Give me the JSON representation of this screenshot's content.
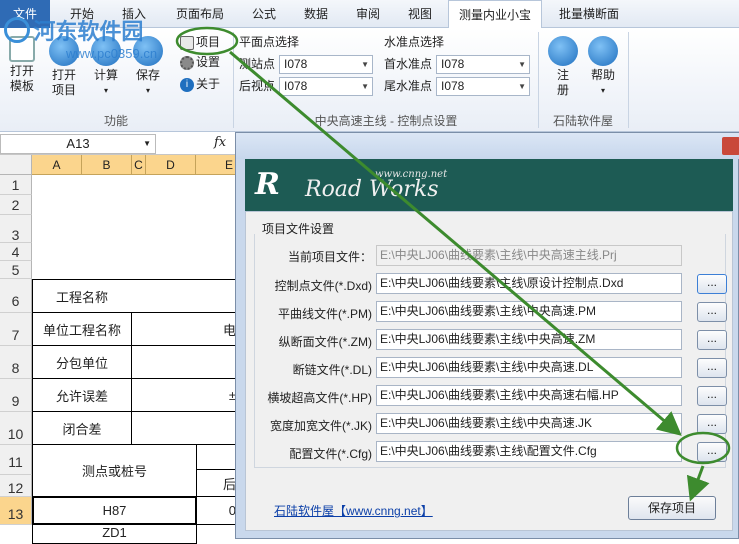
{
  "watermark": {
    "site": "河东软件园",
    "url": "www.pc0359.cn"
  },
  "tabs": [
    {
      "label": "文件"
    },
    {
      "label": "开始"
    },
    {
      "label": "插入"
    },
    {
      "label": "页面布局"
    },
    {
      "label": "公式"
    },
    {
      "label": "数据"
    },
    {
      "label": "审阅"
    },
    {
      "label": "视图"
    },
    {
      "label": "测量内业小宝"
    },
    {
      "label": "批量横断面"
    }
  ],
  "ribbon": {
    "function_group": {
      "label": "功能",
      "buttons": [
        {
          "label": "打开",
          "label2": "模板"
        },
        {
          "label": "打开",
          "label2": "项目"
        },
        {
          "label": "计算",
          "label2": "▾"
        },
        {
          "label": "保存",
          "label2": "▾"
        }
      ],
      "small_buttons": [
        {
          "label": "项目"
        },
        {
          "label": "设置"
        },
        {
          "label": "关于"
        }
      ]
    },
    "points_group": {
      "label": "中央高速主线 - 控制点设置",
      "plane_title": "平面点选择",
      "station_label": "测站点",
      "station_value": "I078",
      "backsight_label": "后视点",
      "backsight_value": "I078",
      "level_title": "水准点选择",
      "first_label": "首水准点",
      "first_value": "I078",
      "last_label": "尾水准点",
      "last_value": "I078"
    },
    "shilu_group": {
      "label": "石陆软件屋",
      "register_label": "注",
      "register_label2": "册",
      "help_label": "帮助",
      "help_label2": "▾"
    }
  },
  "formula_bar": {
    "name_box": "A13",
    "fx": "fx"
  },
  "sheet": {
    "columns": [
      "A",
      "B",
      "C",
      "D",
      "E"
    ],
    "rows": [
      "1",
      "2",
      "3",
      "4",
      "5",
      "6",
      "7",
      "8",
      "9",
      "10",
      "11",
      "12",
      "13"
    ],
    "cells": {
      "r6": "工程名称",
      "r7": "单位工程名称",
      "r7b": "电",
      "r8": "分包单位",
      "r9": "允许误差",
      "r9b": "±",
      "r10": "闭合差",
      "r11": "测点或桩号",
      "r12b": "后",
      "r13": "H87",
      "r13b": "0",
      "r14": "ZD1"
    }
  },
  "dialog": {
    "logo_text": "Road Works",
    "logo_url": "www.cnng.net",
    "section": "项目文件设置",
    "fields": [
      {
        "label": "当前项目文件：",
        "value": "E:\\中央LJ06\\曲线要素\\主线\\中央高速主线.Prj",
        "readonly": true
      },
      {
        "label": "控制点文件(*.Dxd)",
        "value": "E:\\中央LJ06\\曲线要素\\主线\\原设计控制点.Dxd"
      },
      {
        "label": "平曲线文件(*.PM)",
        "value": "E:\\中央LJ06\\曲线要素\\主线\\中央高速.PM"
      },
      {
        "label": "纵断面文件(*.ZM)",
        "value": "E:\\中央LJ06\\曲线要素\\主线\\中央高速.ZM"
      },
      {
        "label": "断链文件(*.DL)",
        "value": "E:\\中央LJ06\\曲线要素\\主线\\中央高速.DL"
      },
      {
        "label": "横坡超高文件(*.HP)",
        "value": "E:\\中央LJ06\\曲线要素\\主线\\中央高速右幅.HP"
      },
      {
        "label": "宽度加宽文件(*.JK)",
        "value": "E:\\中央LJ06\\曲线要素\\主线\\中央高速.JK"
      },
      {
        "label": "配置文件(*.Cfg)",
        "value": "E:\\中央LJ06\\曲线要素\\主线\\配置文件.Cfg"
      }
    ],
    "browse_label": "...",
    "link": "石陆软件屋【www.cnng.net】",
    "save_label": "保存项目"
  },
  "colors": {
    "file_tab": "#2f6bb5",
    "accent_green": "#3d8b2e",
    "banner": "#1d5b54",
    "col_header": "#fbd58d"
  }
}
